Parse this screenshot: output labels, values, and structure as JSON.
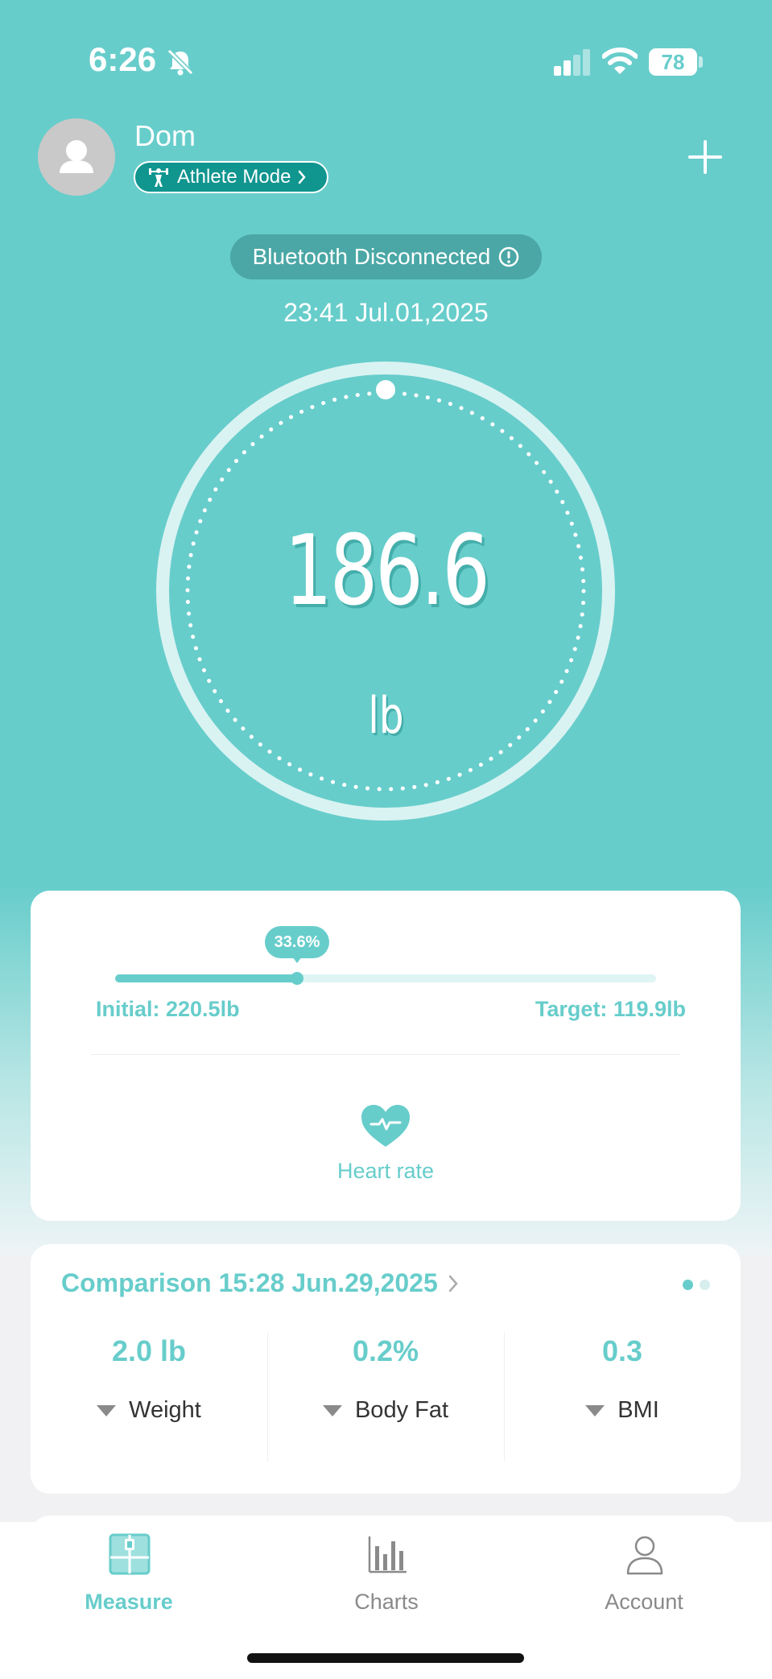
{
  "status_bar": {
    "time": "6:26",
    "battery": "78"
  },
  "profile": {
    "name": "Dom",
    "mode_label": "Athlete Mode"
  },
  "connection": {
    "status": "Bluetooth Disconnected"
  },
  "measurement": {
    "timestamp": "23:41 Jul.01,2025",
    "weight": "186.6",
    "unit": "lb"
  },
  "goal": {
    "progress_label": "33.6%",
    "progress_fraction": 0.336,
    "initial": "Initial: 220.5lb",
    "target": "Target: 119.9lb",
    "heart_rate_label": "Heart rate"
  },
  "comparison": {
    "title": "Comparison 15:28 Jun.29,2025",
    "stats": [
      {
        "value": "2.0 lb",
        "label": "Weight"
      },
      {
        "value": "0.2%",
        "label": "Body Fat"
      },
      {
        "value": "0.3",
        "label": "BMI"
      }
    ]
  },
  "tabs": [
    {
      "label": "Measure",
      "active": true
    },
    {
      "label": "Charts",
      "active": false
    },
    {
      "label": "Account",
      "active": false
    }
  ],
  "colors": {
    "accent": "#67cdcb",
    "dark_teal": "#10958f",
    "inactive": "#8a8a8a"
  }
}
